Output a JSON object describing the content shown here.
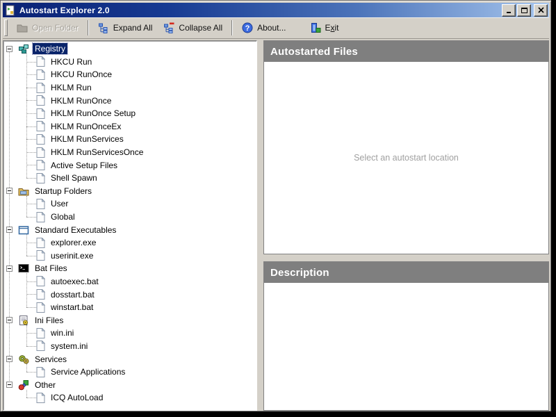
{
  "window": {
    "title": "Autostart Explorer 2.0"
  },
  "toolbar": {
    "open_folder": "Open Folder",
    "expand_all": "Expand All",
    "collapse_all": "Collapse All",
    "about": "About...",
    "exit_pre": "E",
    "exit_accel": "x",
    "exit_post": "it"
  },
  "tree": {
    "groups": [
      {
        "label": "Registry",
        "icon": "registry-icon",
        "selected": true,
        "children": [
          "HKCU Run",
          "HKCU RunOnce",
          "HKLM Run",
          "HKLM RunOnce",
          "HKLM RunOnce Setup",
          "HKLM RunOnceEx",
          "HKLM RunServices",
          "HKLM RunServicesOnce",
          "Active Setup Files",
          "Shell Spawn"
        ]
      },
      {
        "label": "Startup Folders",
        "icon": "startup-folder-icon",
        "selected": false,
        "children": [
          "User",
          "Global"
        ]
      },
      {
        "label": "Standard Executables",
        "icon": "window-frame-icon",
        "selected": false,
        "children": [
          "explorer.exe",
          "userinit.exe"
        ]
      },
      {
        "label": "Bat Files",
        "icon": "dos-icon",
        "selected": false,
        "children": [
          "autoexec.bat",
          "dosstart.bat",
          "winstart.bat"
        ]
      },
      {
        "label": "Ini Files",
        "icon": "ini-file-icon",
        "selected": false,
        "children": [
          "win.ini",
          "system.ini"
        ]
      },
      {
        "label": "Services",
        "icon": "gears-icon",
        "selected": false,
        "children": [
          "Service Applications"
        ]
      },
      {
        "label": "Other",
        "icon": "shapes-icon",
        "selected": false,
        "children": [
          "ICQ AutoLoad"
        ]
      }
    ],
    "item_icon": "page-icon"
  },
  "panels": {
    "files": {
      "title": "Autostarted Files",
      "placeholder": "Select an autostart location"
    },
    "description": {
      "title": "Description"
    }
  },
  "toolbar_icons": {
    "open_folder": "folder-icon",
    "expand_all": "expand-tree-icon",
    "collapse_all": "collapse-tree-icon",
    "about": "help-icon",
    "exit": "exit-door-icon"
  },
  "colors": {
    "titlebar_start": "#0a2174",
    "titlebar_end": "#a8c7ee",
    "chrome": "#d4d0c8",
    "panel_header": "#7f7f7f",
    "selection": "#0a246a",
    "disabled_text": "#a6a29a",
    "placeholder_text": "#a0a0a0"
  }
}
